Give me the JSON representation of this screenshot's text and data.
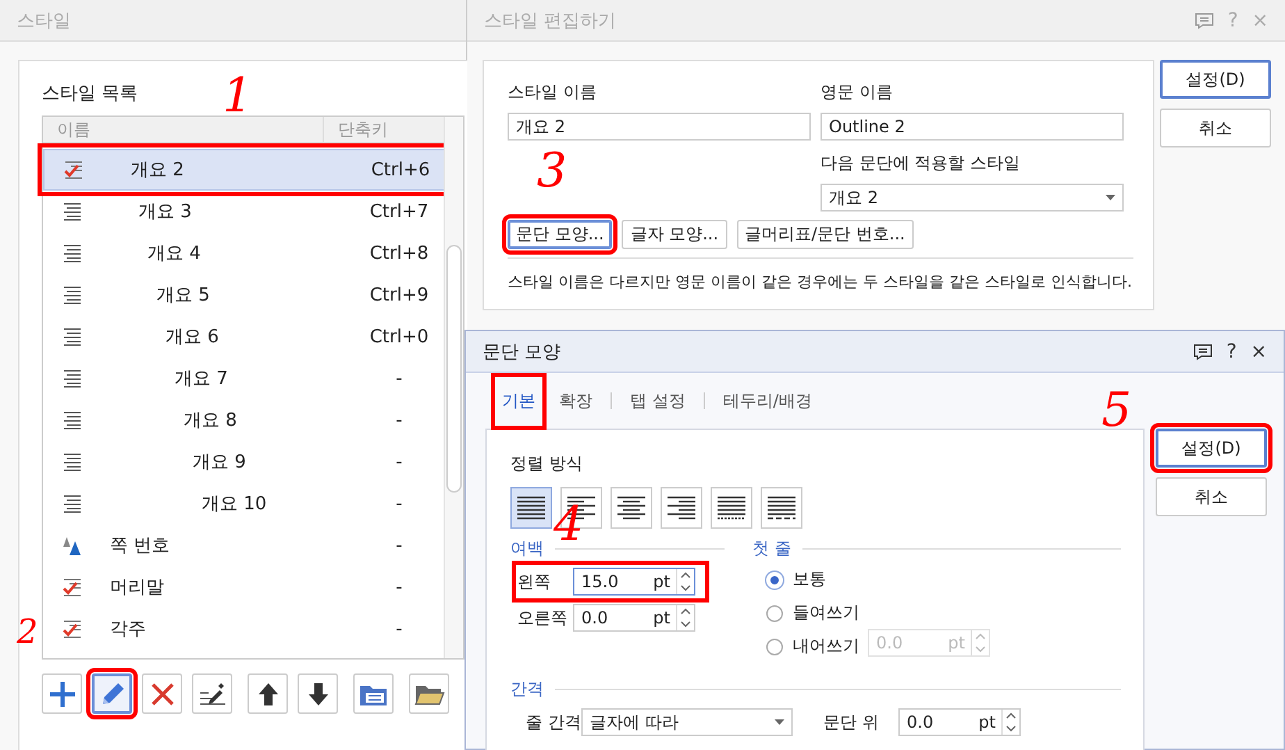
{
  "style_window": {
    "title": "스타일",
    "group_label": "스타일 목록",
    "columns": [
      "이름",
      "단축키"
    ],
    "rows": [
      {
        "name": "개요 2",
        "shortcut": "Ctrl+6",
        "kind": "checked",
        "outline": true,
        "selected": true,
        "highlighted": true
      },
      {
        "name": "개요 3",
        "shortcut": "Ctrl+7",
        "kind": "paragraph",
        "outline": true,
        "selected": false,
        "highlighted": false
      },
      {
        "name": "개요 4",
        "shortcut": "Ctrl+8",
        "kind": "paragraph",
        "outline": true,
        "selected": false,
        "highlighted": false
      },
      {
        "name": "개요 5",
        "shortcut": "Ctrl+9",
        "kind": "paragraph",
        "outline": true,
        "selected": false,
        "highlighted": false
      },
      {
        "name": "개요 6",
        "shortcut": "Ctrl+0",
        "kind": "paragraph",
        "outline": true,
        "selected": false,
        "highlighted": false
      },
      {
        "name": "개요 7",
        "shortcut": "-",
        "kind": "paragraph",
        "outline": true,
        "selected": false,
        "highlighted": false
      },
      {
        "name": "개요 8",
        "shortcut": "-",
        "kind": "paragraph",
        "outline": true,
        "selected": false,
        "highlighted": false
      },
      {
        "name": "개요 9",
        "shortcut": "-",
        "kind": "paragraph",
        "outline": true,
        "selected": false,
        "highlighted": false
      },
      {
        "name": "개요 10",
        "shortcut": "-",
        "kind": "paragraph",
        "outline": true,
        "selected": false,
        "highlighted": false
      },
      {
        "name": "쪽 번호",
        "shortcut": "-",
        "kind": "character",
        "outline": false,
        "selected": false,
        "highlighted": false
      },
      {
        "name": "머리말",
        "shortcut": "-",
        "kind": "checked",
        "outline": false,
        "selected": false,
        "highlighted": false
      },
      {
        "name": "각주",
        "shortcut": "-",
        "kind": "checked",
        "outline": false,
        "selected": false,
        "highlighted": false
      }
    ],
    "toolbar": [
      {
        "kind": "add",
        "selected": false,
        "highlighted": false
      },
      {
        "kind": "edit",
        "selected": true,
        "highlighted": true
      },
      {
        "kind": "delete",
        "selected": false,
        "highlighted": false
      },
      {
        "kind": "pick",
        "selected": false,
        "highlighted": false
      },
      {
        "kind": "up",
        "selected": false,
        "highlighted": false
      },
      {
        "kind": "down",
        "selected": false,
        "highlighted": false
      },
      {
        "kind": "import",
        "selected": false,
        "highlighted": false
      },
      {
        "kind": "folder",
        "selected": false,
        "highlighted": false
      }
    ]
  },
  "edit_window": {
    "title": "스타일 편집하기",
    "title_buttons": [
      "?",
      "×"
    ],
    "style_name": {
      "label": "스타일 이름",
      "value": "개요 2"
    },
    "english_name": {
      "label": "영문 이름",
      "value": "Outline 2"
    },
    "next_style": {
      "label": "다음 문단에 적용할 스타일",
      "value": "개요 2"
    },
    "buttons": [
      {
        "label": "문단 모양...",
        "selected": true,
        "highlighted": true
      },
      {
        "label": "글자 모양...",
        "selected": false,
        "highlighted": false
      },
      {
        "label": "글머리표/문단 번호...",
        "selected": false,
        "highlighted": false
      }
    ],
    "note": "스타일 이름은 다르지만 영문 이름이 같은 경우에는 두 스타일을 같은 스타일로 인식합니다.",
    "side_buttons": [
      {
        "label": "설정(D)",
        "selected": true,
        "highlighted": false
      },
      {
        "label": "취소",
        "selected": false,
        "highlighted": false
      }
    ]
  },
  "paragraph_dialog": {
    "title": "문단 모양",
    "title_buttons": [
      "?",
      "×"
    ],
    "tabs": [
      {
        "label": "기본",
        "selected": true,
        "highlighted": true
      },
      {
        "label": "확장",
        "selected": false
      },
      {
        "label": "탭 설정",
        "selected": false
      },
      {
        "label": "테두리/배경",
        "selected": false
      }
    ],
    "alignment": {
      "label": "정렬 방식",
      "options": [
        {
          "kind": "justify",
          "selected": true
        },
        {
          "kind": "left",
          "selected": false
        },
        {
          "kind": "center",
          "selected": false
        },
        {
          "kind": "right",
          "selected": false
        },
        {
          "kind": "distribute",
          "selected": false
        },
        {
          "kind": "divide",
          "selected": false
        }
      ]
    },
    "margins": {
      "label": "여백",
      "fields": [
        {
          "label": "왼쪽",
          "value": "15.0",
          "unit": "pt",
          "highlighted": true
        },
        {
          "label": "오른쪽",
          "value": "0.0",
          "unit": "pt",
          "highlighted": false
        }
      ]
    },
    "first_line": {
      "label": "첫 줄",
      "options": [
        {
          "label": "보통",
          "selected": true
        },
        {
          "label": "들여쓰기",
          "selected": false
        },
        {
          "label": "내어쓰기",
          "selected": false
        }
      ],
      "amount": {
        "value": "0.0",
        "unit": "pt",
        "disabled": true
      }
    },
    "spacing": {
      "label": "간격",
      "line_spacing": {
        "label": "줄 간격",
        "value": "글자에 따라"
      },
      "before": {
        "label": "문단 위",
        "value": "0.0",
        "unit": "pt"
      }
    },
    "side_buttons": [
      {
        "label": "설정(D)",
        "selected": true,
        "highlighted": true
      },
      {
        "label": "취소",
        "selected": false,
        "highlighted": false
      }
    ]
  },
  "annotations": [
    {
      "label": "1"
    },
    {
      "label": "2"
    },
    {
      "label": "3"
    },
    {
      "label": "4"
    },
    {
      "label": "5"
    }
  ]
}
